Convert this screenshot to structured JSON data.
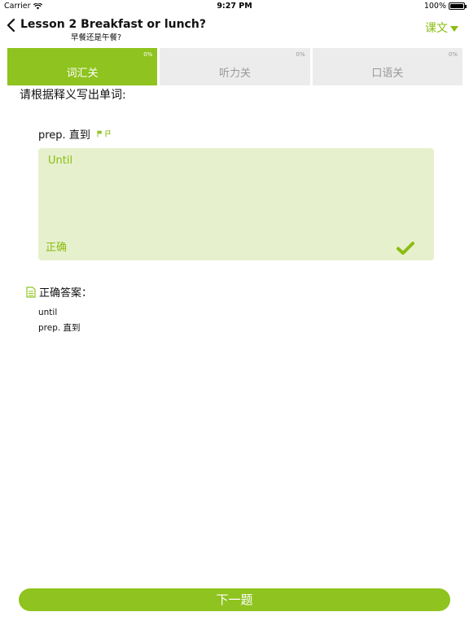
{
  "status_bar": {
    "carrier": "Carrier",
    "time": "9:27 PM",
    "battery": "100%"
  },
  "nav": {
    "title": "Lesson 2 Breakfast or lunch?",
    "subtitle": "早餐还是午餐?",
    "text_menu_label": "课文"
  },
  "tabs": [
    {
      "label": "词汇关",
      "percent": "0%",
      "active": true
    },
    {
      "label": "听力关",
      "percent": "0%",
      "active": false
    },
    {
      "label": "口语关",
      "percent": "0%",
      "active": false
    }
  ],
  "question": {
    "instruction": "请根据释义写出单词:",
    "definition": "prep. 直到"
  },
  "answer": {
    "input_value": "Until",
    "result": "正确"
  },
  "correct_answer": {
    "header": "正确答案：",
    "word": "until",
    "definition": "prep. 直到"
  },
  "next_button": "下一题",
  "colors": {
    "accent": "#8fc31f",
    "answer_bg": "#e6f0cd",
    "tab_inactive": "#ececec"
  }
}
